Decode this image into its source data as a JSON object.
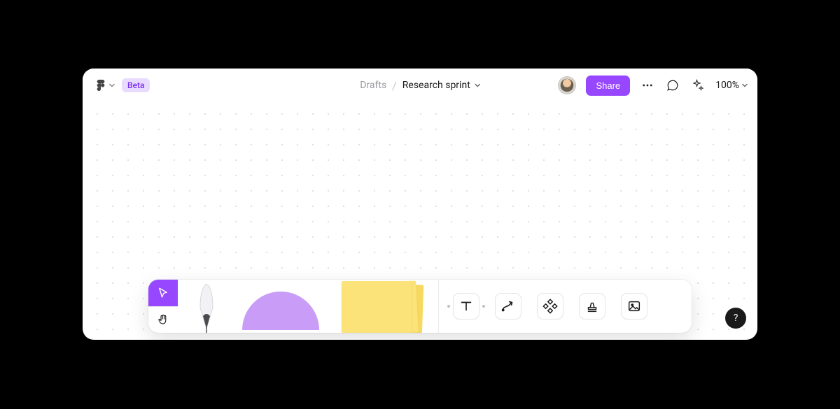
{
  "header": {
    "badge": "Beta",
    "breadcrumb_parent": "Drafts",
    "document_title": "Research sprint",
    "share_label": "Share",
    "zoom_label": "100%"
  },
  "toolbar": {
    "left": {
      "select_icon": "cursor-icon",
      "hand_icon": "hand-icon"
    },
    "big": {
      "pen_icon": "pen-icon",
      "shape_icon": "circle-shape-icon",
      "sticky_icon": "sticky-note-icon"
    },
    "right": [
      {
        "name": "text-tool-icon"
      },
      {
        "name": "connector-tool-icon"
      },
      {
        "name": "components-icon"
      },
      {
        "name": "stamp-icon"
      },
      {
        "name": "image-icon"
      }
    ]
  },
  "help": {
    "label": "?"
  },
  "colors": {
    "accent": "#9747ff",
    "beta_bg": "#e8dbff",
    "shape_fill": "#c89cf7",
    "sticky_fill": "#fbe37a"
  }
}
